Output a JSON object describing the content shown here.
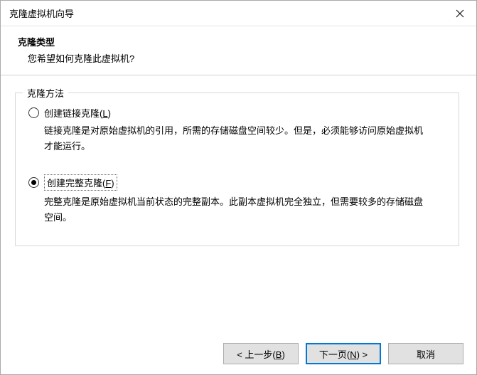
{
  "window": {
    "title": "克隆虚拟机向导"
  },
  "header": {
    "title": "克隆类型",
    "sub": "您希望如何克隆此虚拟机?"
  },
  "group": {
    "label": "克隆方法"
  },
  "options": {
    "linked": {
      "label_pre": "创建链接克隆(",
      "mnemonic": "L",
      "label_post": ")",
      "desc": "链接克隆是对原始虚拟机的引用，所需的存储磁盘空间较少。但是，必须能够访问原始虚拟机才能运行。",
      "checked": false
    },
    "full": {
      "label_pre": "创建完整克隆(",
      "mnemonic": "F",
      "label_post": ")",
      "desc": "完整克隆是原始虚拟机当前状态的完整副本。此副本虚拟机完全独立，但需要较多的存储磁盘空间。",
      "checked": true
    }
  },
  "footer": {
    "back_pre": "< 上一步(",
    "back_mn": "B",
    "back_post": ")",
    "next_pre": "下一页(",
    "next_mn": "N",
    "next_post": ") >",
    "cancel": "取消"
  }
}
